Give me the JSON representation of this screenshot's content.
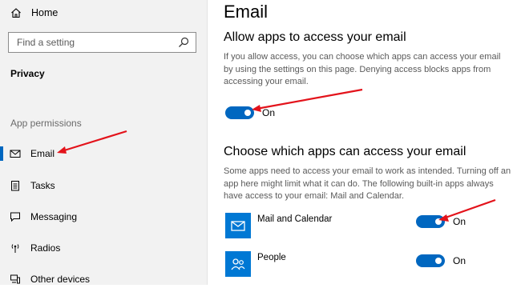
{
  "sidebar": {
    "home_label": "Home",
    "search_placeholder": "Find a setting",
    "privacy_label": "Privacy",
    "section_label": "App permissions",
    "items": [
      {
        "label": "Email",
        "icon": "mail-icon",
        "selected": true
      },
      {
        "label": "Tasks",
        "icon": "tasks-icon",
        "selected": false
      },
      {
        "label": "Messaging",
        "icon": "messaging-icon",
        "selected": false
      },
      {
        "label": "Radios",
        "icon": "radios-icon",
        "selected": false
      },
      {
        "label": "Other devices",
        "icon": "other-devices-icon",
        "selected": false
      }
    ]
  },
  "main": {
    "title": "Email",
    "allow_heading": "Allow apps to access your email",
    "allow_description": "If you allow access, you can choose which apps can access your email by using the settings on this page. Denying access blocks apps from accessing your email.",
    "allow_toggle_state": "On",
    "choose_heading": "Choose which apps can access your email",
    "choose_description": "Some apps need to access your email to work as intended. Turning off an app here might limit what it can do. The following built-in apps always have access to your email: Mail and Calendar.",
    "apps": [
      {
        "name": "Mail and Calendar",
        "icon": "mail-calendar-app-icon",
        "state": "On"
      },
      {
        "name": "People",
        "icon": "people-app-icon",
        "state": "On"
      }
    ]
  },
  "colors": {
    "accent": "#0067c0",
    "app_tile": "#0078d4",
    "annotation_arrow": "#e3131b"
  }
}
